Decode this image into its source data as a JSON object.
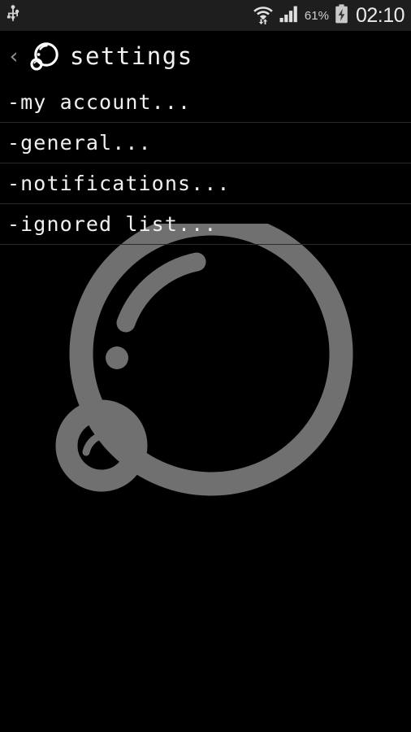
{
  "status_bar": {
    "usb_icon": "usb-icon",
    "wifi_icon": "wifi-transfer-icon",
    "signal_icon": "cellular-signal-icon",
    "battery_percent": "61%",
    "battery_icon": "battery-charging-icon",
    "clock": "02:10",
    "background_color": "#1e1e1e"
  },
  "title_bar": {
    "back_icon": "‹",
    "logo_icon": "bubble-logo-icon",
    "title": "settings"
  },
  "settings_list": {
    "items": [
      {
        "label": "-my account...",
        "name": "my-account"
      },
      {
        "label": "-general...",
        "name": "general"
      },
      {
        "label": "-notifications...",
        "name": "notifications"
      },
      {
        "label": "-ignored list...",
        "name": "ignored-list"
      }
    ]
  },
  "watermark": {
    "icon": "bubble-logo-watermark",
    "color": "#707070"
  },
  "colors": {
    "background": "#000000",
    "text": "#f0f0f0",
    "divider": "#2a2a2a",
    "watermark_gray": "#707070",
    "status_bar": "#1e1e1e"
  }
}
